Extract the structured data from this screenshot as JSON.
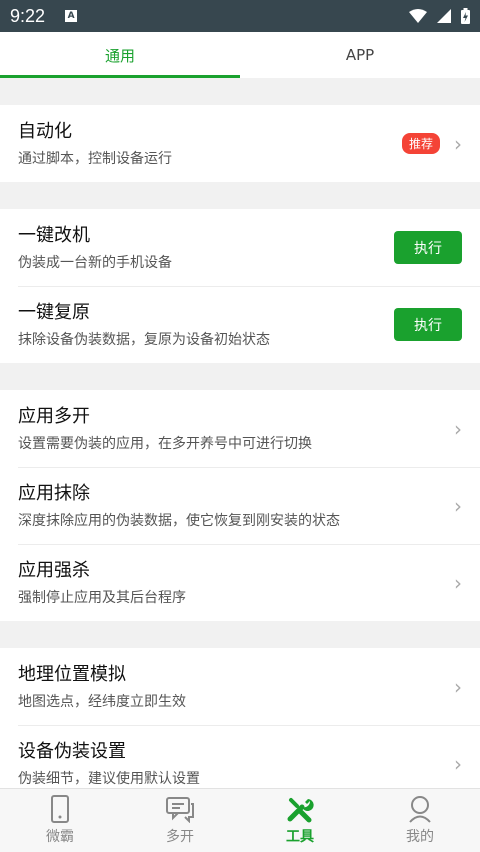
{
  "status_bar": {
    "time": "9:22",
    "app_icon": "A"
  },
  "tabs": [
    {
      "label": "通用",
      "active": true
    },
    {
      "label": "APP",
      "active": false
    }
  ],
  "groups": [
    {
      "rows": [
        {
          "title": "自动化",
          "subtitle": "通过脚本，控制设备运行",
          "badge": "推荐",
          "action": "chevron"
        }
      ]
    },
    {
      "rows": [
        {
          "title": "一键改机",
          "subtitle": "伪装成一台新的手机设备",
          "button": "执行"
        },
        {
          "title": "一键复原",
          "subtitle": "抹除设备伪装数据，复原为设备初始状态",
          "button": "执行"
        }
      ]
    },
    {
      "rows": [
        {
          "title": "应用多开",
          "subtitle": "设置需要伪装的应用，在多开养号中可进行切换"
        },
        {
          "title": "应用抹除",
          "subtitle": "深度抹除应用的伪装数据，使它恢复到刚安装的状态"
        },
        {
          "title": "应用强杀",
          "subtitle": "强制停止应用及其后台程序"
        }
      ]
    },
    {
      "rows": [
        {
          "title": "地理位置模拟",
          "subtitle": "地图选点，经纬度立即生效"
        },
        {
          "title": "设备伪装设置",
          "subtitle": "伪装细节，建议使用默认设置"
        }
      ]
    }
  ],
  "bottom_nav": [
    {
      "label": "微霸",
      "icon": "phone-icon",
      "active": false
    },
    {
      "label": "多开",
      "icon": "chat-icon",
      "active": false
    },
    {
      "label": "工具",
      "icon": "tools-icon",
      "active": true
    },
    {
      "label": "我的",
      "icon": "person-icon",
      "active": false
    }
  ],
  "colors": {
    "accent": "#1aa12e",
    "badge": "#f44336",
    "statusbar": "#37474f"
  }
}
